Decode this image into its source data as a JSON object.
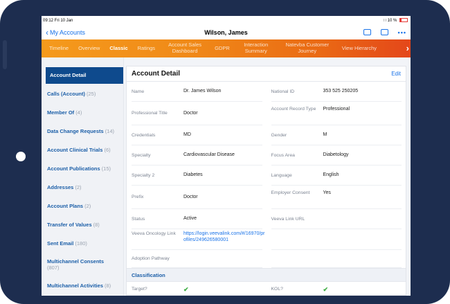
{
  "status_bar": {
    "time": "09:12  Fri 10 Jan",
    "wifi": "∷",
    "battery": "10 %"
  },
  "navbar": {
    "back_label": "My Accounts",
    "title": "Wilson, James",
    "icons": [
      "id-card-icon",
      "calendar-icon",
      "more-icon"
    ]
  },
  "tabs": [
    {
      "label": "Timeline",
      "active": false
    },
    {
      "label": "Overview",
      "active": false
    },
    {
      "label": "Classic",
      "active": true
    },
    {
      "label": "Ratings",
      "active": false
    },
    {
      "label": "Account Sales Dashboard",
      "active": false
    },
    {
      "label": "GDPR",
      "active": false
    },
    {
      "label": "Interaction Summary",
      "active": false
    },
    {
      "label": "Natevba Customer Journey",
      "active": false
    },
    {
      "label": "View Hierarchy",
      "active": false
    }
  ],
  "sidebar": [
    {
      "label": "Account Detail",
      "count": "",
      "active": true
    },
    {
      "label": "Calls (Account)",
      "count": "(25)"
    },
    {
      "label": "Member Of",
      "count": "(4)"
    },
    {
      "label": "Data Change Requests",
      "count": "(14)"
    },
    {
      "label": "Account Clinical Trials",
      "count": "(6)"
    },
    {
      "label": "Account Publications",
      "count": "(15)"
    },
    {
      "label": "Addresses",
      "count": "(2)"
    },
    {
      "label": "Account Plans",
      "count": "(2)"
    },
    {
      "label": "Transfer of Values",
      "count": "(8)"
    },
    {
      "label": "Sent Email",
      "count": "(180)"
    },
    {
      "label": "Multichannel Consents",
      "count": "(807)"
    },
    {
      "label": "Multichannel Activities",
      "count": "(8)"
    }
  ],
  "panel": {
    "title": "Account Detail",
    "edit_label": "Edit",
    "rows": [
      {
        "l1": "Name",
        "v1": "Dr. James Wilson",
        "l2": "National ID",
        "v2": "353 525 250205"
      },
      {
        "l1": "Professional Title",
        "v1": "Doctor",
        "l2": "Account Record Type",
        "v2": "Professional"
      },
      {
        "l1": "Credentials",
        "v1": "MD",
        "l2": "Gender",
        "v2": "M"
      },
      {
        "l1": "Specialty",
        "v1": "Cardiovascular Disease",
        "l2": "Focus Area",
        "v2": "Diabetology"
      },
      {
        "l1": "Specialty 2",
        "v1": "Diabetes",
        "l2": "Language",
        "v2": "English"
      },
      {
        "l1": "Prefix",
        "v1": "Doctor",
        "l2": "Employer Consent",
        "v2": "Yes"
      },
      {
        "l1": "Status",
        "v1": "Active",
        "l2": "Veeva Link URL",
        "v2": ""
      },
      {
        "l1": "Veeva Oncology Link",
        "v1": "https://login.veevalink.com/#/16970/profiles/249626580001",
        "l2": "",
        "v2": ""
      },
      {
        "l1": "Adoption Pathway",
        "v1": "",
        "l2": "",
        "v2": ""
      }
    ],
    "section_title": "Classification",
    "classification": {
      "l1": "Target?",
      "l2": "KOL?",
      "check": "✔"
    }
  },
  "colors": {
    "accent": "#1a73e8",
    "sidebar_active": "#0e4a8d",
    "tab_start": "#f59a1c",
    "tab_end": "#e4471a",
    "frame": "#1d2d4f",
    "check": "#3fae44"
  }
}
